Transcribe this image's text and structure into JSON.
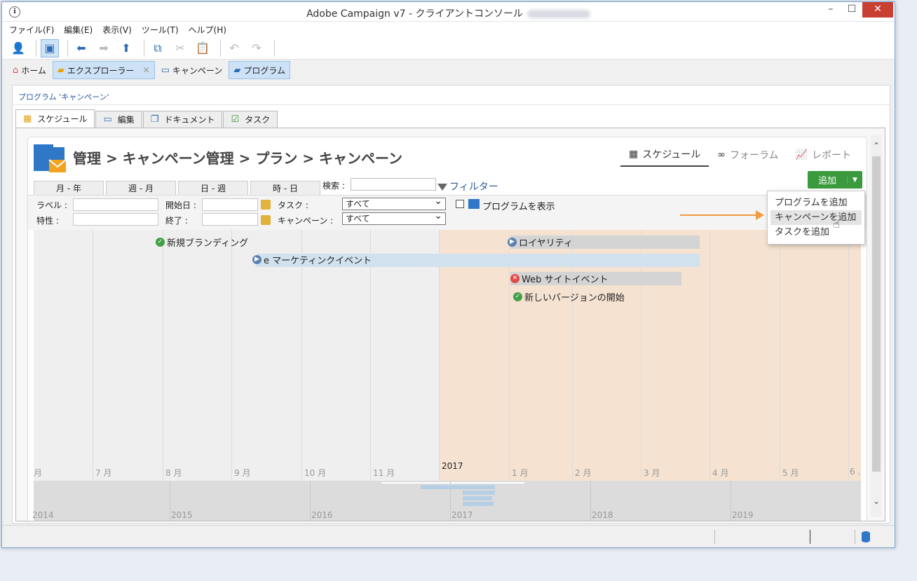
{
  "window": {
    "title": "Adobe Campaign v7 - クライアントコンソール",
    "app_icon": "ℹ",
    "min": "–",
    "max": "☐",
    "close": "✕"
  },
  "menu": [
    "ファイル(F)",
    "編集(E)",
    "表示(V)",
    "ツール(T)",
    "ヘルプ(H)"
  ],
  "nav": {
    "home": "ホーム",
    "explorer": "エクスプローラー",
    "campaign": "キャンペーン",
    "program": "プログラム"
  },
  "breadcrumb": "プログラム 'キャンペーン'",
  "subtabs": [
    "スケジュール",
    "編集",
    "ドキュメント",
    "タスク"
  ],
  "page_title": "管理 > キャンペーン管理 > プラン > キャンペーン",
  "view_tabs": [
    "スケジュール",
    "フォーラム",
    "レポート"
  ],
  "add_button": "追加",
  "add_menu": [
    "プログラムを追加",
    "キャンペーンを追加",
    "タスクを追加"
  ],
  "scale_tabs": [
    "月 - 年",
    "週 - 月",
    "日 - 週",
    "時 - 日"
  ],
  "search": {
    "label": "検索 :",
    "filter": "フィルター"
  },
  "filters": {
    "label": "ラベル :",
    "start": "開始日 :",
    "task": "タスク :",
    "task_value": "すべて",
    "show_program": "プログラムを表示",
    "nature": "特性 :",
    "end": "終了 :",
    "campaign": "キャンペーン :",
    "campaign_value": "すべて"
  },
  "events": [
    {
      "name": "新規ブランディング",
      "status": "ok"
    },
    {
      "name": "e マーケティンクイベント",
      "status": "running"
    },
    {
      "name": "ロイヤリティ",
      "status": "running"
    },
    {
      "name": "Web サイトイベント",
      "status": "error"
    },
    {
      "name": "新しいバージョンの開始",
      "status": "ok"
    }
  ],
  "axis_months": [
    "月",
    "7 月",
    "8 月",
    "9 月",
    "10 月",
    "11 月",
    "1 月",
    "2 月",
    "3 月",
    "4 月",
    "5 月",
    "6 ."
  ],
  "axis_year": "2017",
  "overview_years": [
    "2014",
    "2015",
    "2016",
    "2017",
    "2018",
    "2019"
  ],
  "colors": {
    "accent": "#3b9a3d",
    "shade": "#f5e2d1",
    "arrow": "#f29a3e",
    "link": "#2b5a9a"
  }
}
